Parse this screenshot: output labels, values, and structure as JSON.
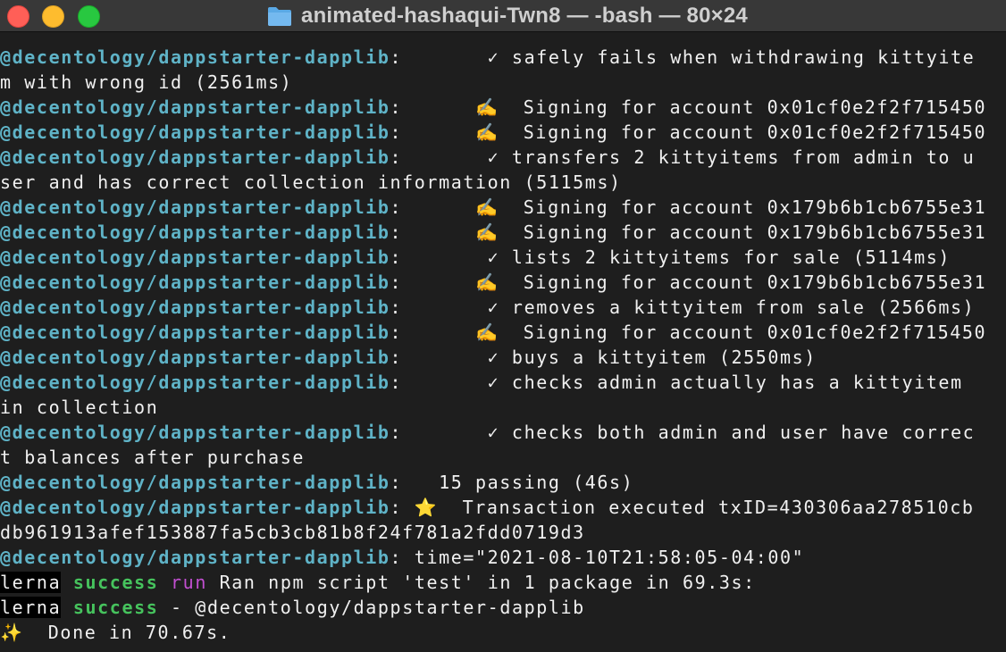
{
  "window": {
    "title": "animated-hashaqui-Twn8 — -bash — 80×24",
    "folder_icon": "folder-icon"
  },
  "colors": {
    "background": "#1e1e1e",
    "titlebar": "#383838",
    "package_prefix": "#5fb3c7",
    "success": "#46c35d",
    "run": "#c24fd1",
    "close": "#ff5f57",
    "minimize": "#febc2e",
    "maximize": "#28c840"
  },
  "terminal": {
    "prefix": "@decentology/dappstarter-dapplib",
    "lines": [
      {
        "prefix": "@decentology/dappstarter-dapplib",
        "text": ":       ✓ safely fails when withdrawing kittyite"
      },
      {
        "prefix": "",
        "text": "m with wrong id (2561ms)"
      },
      {
        "prefix": "@decentology/dappstarter-dapplib",
        "text": ":      ✍️  Signing for account 0x01cf0e2f2f715450"
      },
      {
        "prefix": "@decentology/dappstarter-dapplib",
        "text": ":      ✍️  Signing for account 0x01cf0e2f2f715450"
      },
      {
        "prefix": "@decentology/dappstarter-dapplib",
        "text": ":       ✓ transfers 2 kittyitems from admin to u"
      },
      {
        "prefix": "",
        "text": "ser and has correct collection information (5115ms)"
      },
      {
        "prefix": "@decentology/dappstarter-dapplib",
        "text": ":      ✍️  Signing for account 0x179b6b1cb6755e31"
      },
      {
        "prefix": "@decentology/dappstarter-dapplib",
        "text": ":      ✍️  Signing for account 0x179b6b1cb6755e31"
      },
      {
        "prefix": "@decentology/dappstarter-dapplib",
        "text": ":       ✓ lists 2 kittyitems for sale (5114ms)"
      },
      {
        "prefix": "@decentology/dappstarter-dapplib",
        "text": ":      ✍️  Signing for account 0x179b6b1cb6755e31"
      },
      {
        "prefix": "@decentology/dappstarter-dapplib",
        "text": ":       ✓ removes a kittyitem from sale (2566ms)"
      },
      {
        "prefix": "@decentology/dappstarter-dapplib",
        "text": ":      ✍️  Signing for account 0x01cf0e2f2f715450"
      },
      {
        "prefix": "@decentology/dappstarter-dapplib",
        "text": ":       ✓ buys a kittyitem (2550ms)"
      },
      {
        "prefix": "@decentology/dappstarter-dapplib",
        "text": ":       ✓ checks admin actually has a kittyitem"
      },
      {
        "prefix": "",
        "text": "in collection"
      },
      {
        "prefix": "@decentology/dappstarter-dapplib",
        "text": ":       ✓ checks both admin and user have correc"
      },
      {
        "prefix": "",
        "text": "t balances after purchase"
      },
      {
        "prefix": "@decentology/dappstarter-dapplib",
        "text": ":   15 passing (46s)"
      },
      {
        "prefix": "@decentology/dappstarter-dapplib",
        "text": ": ⭐  Transaction executed txID=430306aa278510cb"
      },
      {
        "prefix": "",
        "text": "db961913afef153887fa5cb3cb81b8f24f781a2fdd0719d3"
      },
      {
        "prefix": "@decentology/dappstarter-dapplib",
        "text": ": time=\"2021-08-10T21:58:05-04:00\""
      }
    ],
    "lerna_lines": [
      {
        "tag": "lerna",
        "status": "success",
        "run": "run",
        "message": " Ran npm script 'test' in 1 package in 69.3s:"
      },
      {
        "tag": "lerna",
        "status": "success",
        "run": "",
        "message": " - @decentology/dappstarter-dapplib"
      }
    ],
    "done_line": "✨  Done in 70.67s."
  }
}
